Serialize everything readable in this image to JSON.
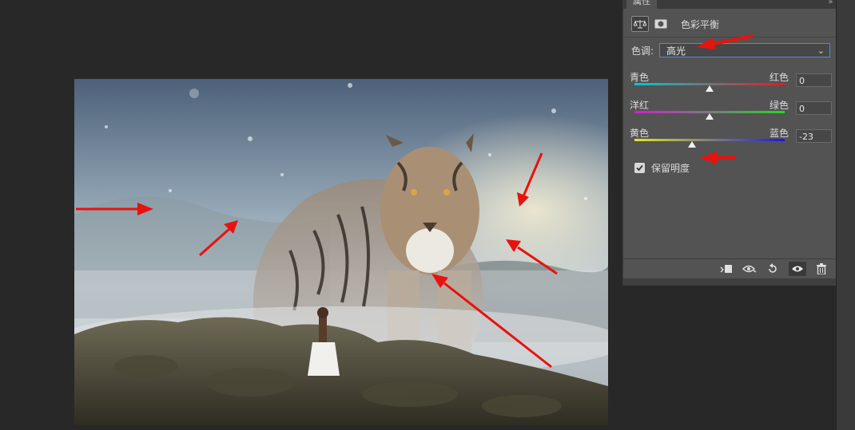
{
  "panel": {
    "tab_label": "属性",
    "menu_glyph": "»  ≡",
    "title": "色彩平衡",
    "tone_label": "色调:",
    "tone_value": "高光",
    "sliders": [
      {
        "left": "青色",
        "right": "红色",
        "value": "0",
        "level": 0
      },
      {
        "left": "洋红",
        "right": "绿色",
        "value": "0",
        "level": 0
      },
      {
        "left": "黄色",
        "right": "蓝色",
        "value": "-23",
        "level": -23
      }
    ],
    "preserve_label": "保留明度",
    "preserve_checked": true
  },
  "colors": {
    "accent_blue": "#4f8ad6",
    "panel_bg": "#535353",
    "annotation_red": "#e8120e"
  }
}
